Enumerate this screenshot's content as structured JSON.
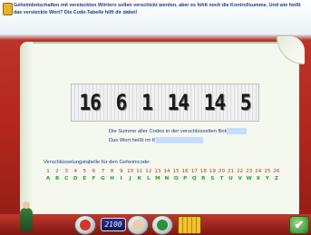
{
  "banner": {
    "text": "Geheimbotschaften mit versteckten Wörtern sollen verschickt werden, aber es fehlt noch die Kontrollsumme. Und wie heißt das versteckte Wort? Die Code-Tabelle hilft dir dabei!"
  },
  "codes": [
    "16",
    "6",
    "1",
    "14",
    "14",
    "5"
  ],
  "questions": {
    "sum_label": "Die Summe aller Codes in der verschlüsselten Botschaft:",
    "sum_value": "",
    "word_label": "Das Wort heißt im Klartext:",
    "word_value": ""
  },
  "table": {
    "title": "Verschlüsselungstabelle für den Geheimcode:",
    "numbers": [
      "1",
      "2",
      "3",
      "4",
      "5",
      "6",
      "7",
      "8",
      "9",
      "10",
      "11",
      "12",
      "13",
      "14",
      "15",
      "16",
      "17",
      "18",
      "19",
      "20",
      "21",
      "22",
      "23",
      "24",
      "25",
      "26"
    ],
    "letters": [
      "A",
      "B",
      "C",
      "D",
      "E",
      "F",
      "G",
      "H",
      "I",
      "J",
      "K",
      "L",
      "M",
      "N",
      "O",
      "P",
      "Q",
      "R",
      "S",
      "T",
      "U",
      "V",
      "W",
      "X",
      "Y",
      "Z"
    ]
  },
  "toolbar": {
    "counter": "2100",
    "check_icon": "✔"
  },
  "colors": {
    "background_red": "#c0392b",
    "banner_text_blue": "#1e3a8a",
    "number_red": "#c0392b",
    "letter_green": "#2e9d3a",
    "input_blue": "#c8dcff"
  }
}
